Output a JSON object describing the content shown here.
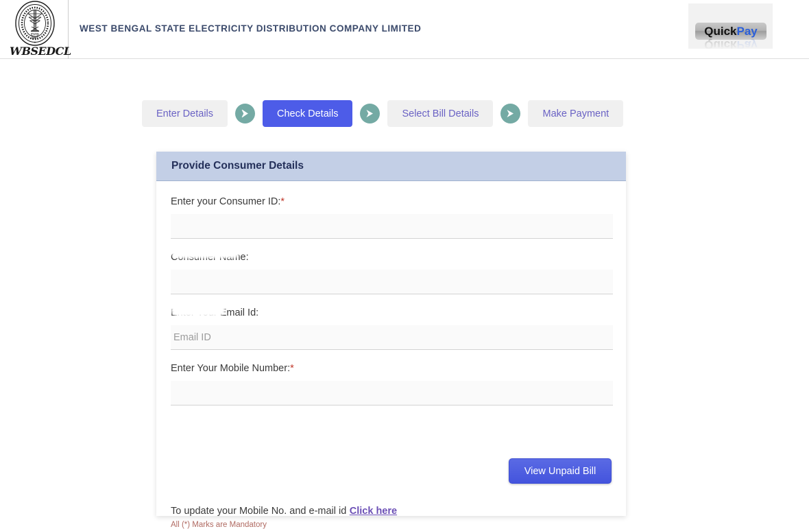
{
  "header": {
    "logo_alt": "wbsedcl-seal-logo",
    "logo_seal_estd_label": "ESTD",
    "logo_seal_estd_year": "2007",
    "logo_seal_ring_text": "WEST BENGAL STATE ELECTRICITY DISTRIBUTION COMPANY LIMITED",
    "logo_wordmark": "WBSEDCL",
    "company_title": "WEST BENGAL STATE ELECTRICITY DISTRIBUTION COMPANY LIMITED",
    "quick_pay": {
      "label_part_1": "Quick",
      "label_part_2": "Pay"
    }
  },
  "stepper": {
    "steps": [
      {
        "label": "Enter Details",
        "active": false
      },
      {
        "label": "Check Details",
        "active": true
      },
      {
        "label": "Select Bill Details",
        "active": false
      },
      {
        "label": "Make Payment",
        "active": false
      }
    ],
    "arrow_icon": "arrow-right-icon"
  },
  "card": {
    "title": "Provide Consumer Details",
    "fields": [
      {
        "label": "Enter your Consumer ID:",
        "required": true,
        "value": "",
        "placeholder": "",
        "redacted": true
      },
      {
        "label": "Consumer Name:",
        "required": false,
        "value": "",
        "placeholder": "",
        "redacted": true
      },
      {
        "label": "Enter Your Email Id:",
        "required": false,
        "value": "",
        "placeholder": "Email ID",
        "redacted": false
      },
      {
        "label": "Enter Your Mobile Number:",
        "required": true,
        "value": "",
        "placeholder": "",
        "redacted": true
      }
    ],
    "submit_label": "View Unpaid Bill",
    "footer_text": "To update your Mobile No. and e-mail id",
    "footer_link": "Click here",
    "mandatory_note": "All (*) Marks are Mandatory"
  },
  "colors": {
    "accent_blue": "#4d5ce8",
    "step_inactive_bg": "#f0f0f0",
    "step_inactive_text": "#6a62c4",
    "arrow_teal": "#74aaa4",
    "card_header_bg": "#c3cfe6",
    "card_header_text": "#24305a",
    "brand_navy": "#3b4a6b",
    "link_purple": "#6b4fb5",
    "required_red": "#c0392b",
    "mandatory_note_color": "#b06a62"
  }
}
